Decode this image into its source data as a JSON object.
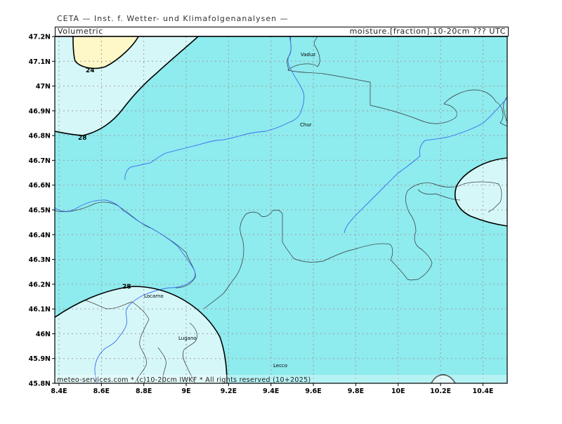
{
  "header": {
    "title": "CETA — Inst. f. Wetter- und Klimafolgenanalysen —"
  },
  "info_bar": {
    "left": "Volumetric",
    "right": "moisture.[fraction].10-20cm ??? UTC"
  },
  "footer": {
    "credit": "meteo-services.com * (c)10-20cm IWKF * All rights reserved (10+2025)"
  },
  "colors": {
    "base_fill": "#8eebee",
    "low_fill": "#d6f7f8",
    "lowest_fill": "#fef7c8",
    "contour": "#000000",
    "river": "#3b6cf0",
    "border": "#333333",
    "grid": "#a0a0a0"
  },
  "axes": {
    "x_ticks": [
      "8.4E",
      "8.6E",
      "8.8E",
      "9E",
      "9.2E",
      "9.4E",
      "9.6E",
      "9.8E",
      "10E",
      "10.2E",
      "10.4E"
    ],
    "y_ticks": [
      "47.2N",
      "47.1N",
      "47N",
      "46.9N",
      "46.8N",
      "46.7N",
      "46.6N",
      "46.5N",
      "46.4N",
      "46.3N",
      "46.2N",
      "46.1N",
      "46N",
      "45.9N",
      "45.8N"
    ]
  },
  "contour_labels": [
    "24",
    "28",
    "28"
  ],
  "cities": [
    "Vaduz",
    "Chur",
    "Locarno",
    "Lugano",
    "Lecco"
  ]
}
